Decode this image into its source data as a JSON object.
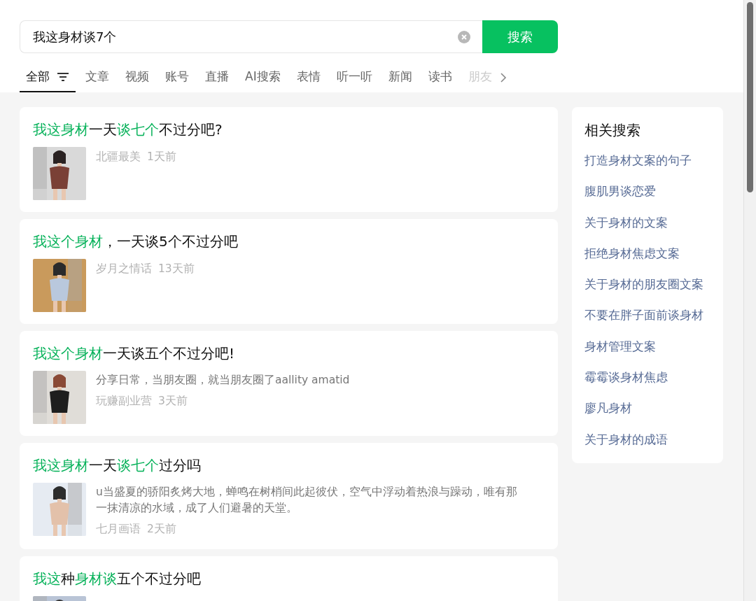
{
  "search": {
    "value": "我这身材谈7个",
    "button": "搜索"
  },
  "tabs": [
    {
      "label": "全部",
      "selected": true,
      "filter": true
    },
    {
      "label": "文章",
      "selected": false
    },
    {
      "label": "视频",
      "selected": false
    },
    {
      "label": "账号",
      "selected": false
    },
    {
      "label": "直播",
      "selected": false
    },
    {
      "label": "AI搜索",
      "selected": false
    },
    {
      "label": "表情",
      "selected": false
    },
    {
      "label": "听一听",
      "selected": false
    },
    {
      "label": "新闻",
      "selected": false
    },
    {
      "label": "读书",
      "selected": false
    },
    {
      "label": "朋友",
      "selected": false,
      "faded": true
    }
  ],
  "results": [
    {
      "title": [
        {
          "text": "我这身材",
          "highlight": true
        },
        {
          "text": "一天",
          "highlight": false
        },
        {
          "text": "谈七个",
          "highlight": true
        },
        {
          "text": "不过分吧?",
          "highlight": false
        }
      ],
      "source": "北疆最美",
      "time": "1天前"
    },
    {
      "title": [
        {
          "text": "我这个身材",
          "highlight": true
        },
        {
          "text": "，一天谈5个不过分吧",
          "highlight": false
        }
      ],
      "source": "岁月之情话",
      "time": "13天前"
    },
    {
      "title": [
        {
          "text": "我这个身材",
          "highlight": true
        },
        {
          "text": "一天谈五个不过分吧!",
          "highlight": false
        }
      ],
      "summary": "分享日常，当朋友圈，就当朋友圈了aallity amatid",
      "source": "玩赚副业营",
      "time": "3天前"
    },
    {
      "title": [
        {
          "text": "我这身材",
          "highlight": true
        },
        {
          "text": "一天",
          "highlight": false
        },
        {
          "text": "谈七个",
          "highlight": true
        },
        {
          "text": "过分吗",
          "highlight": false
        }
      ],
      "summary": "u当盛夏的骄阳炙烤大地，蝉鸣在树梢间此起彼伏，空气中浮动着热浪与躁动，唯有那一抹清凉的水域，成了人们避暑的天堂。",
      "source": "七月画语",
      "time": "2天前"
    },
    {
      "title": [
        {
          "text": "我这",
          "highlight": true
        },
        {
          "text": "种",
          "highlight": false
        },
        {
          "text": "身材谈",
          "highlight": true
        },
        {
          "text": "五个不过分吧",
          "highlight": false
        }
      ]
    }
  ],
  "related": {
    "title": "相关搜索",
    "items": [
      "打造身材文案的句子",
      "腹肌男谈恋爱",
      "关于身材的文案",
      "拒绝身材焦虑文案",
      "关于身材的朋友圈文案",
      "不要在胖子面前谈身材",
      "身材管理文案",
      "霉霉谈身材焦虑",
      "廖凡身材",
      "关于身材的成语"
    ]
  }
}
